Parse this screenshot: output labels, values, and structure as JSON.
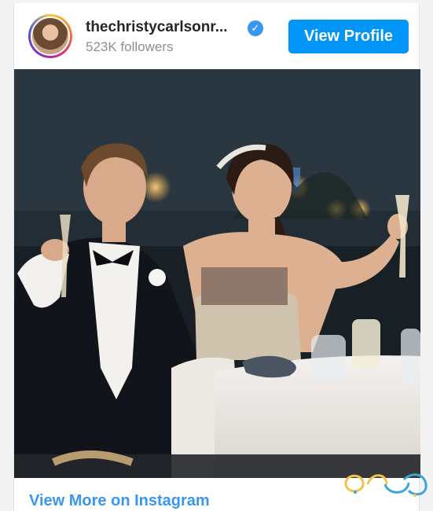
{
  "profile": {
    "username": "thechristycarlsonr...",
    "followers": "523K followers",
    "verified": true
  },
  "actions": {
    "view_profile": "View Profile",
    "view_more": "View More on Instagram"
  },
  "colors": {
    "primary_button": "#0095f6",
    "link": "#3897f0",
    "verified_badge": "#3897f0"
  },
  "icons": {
    "verified": "verified-badge-icon",
    "watermark": "site-logo-watermark"
  }
}
